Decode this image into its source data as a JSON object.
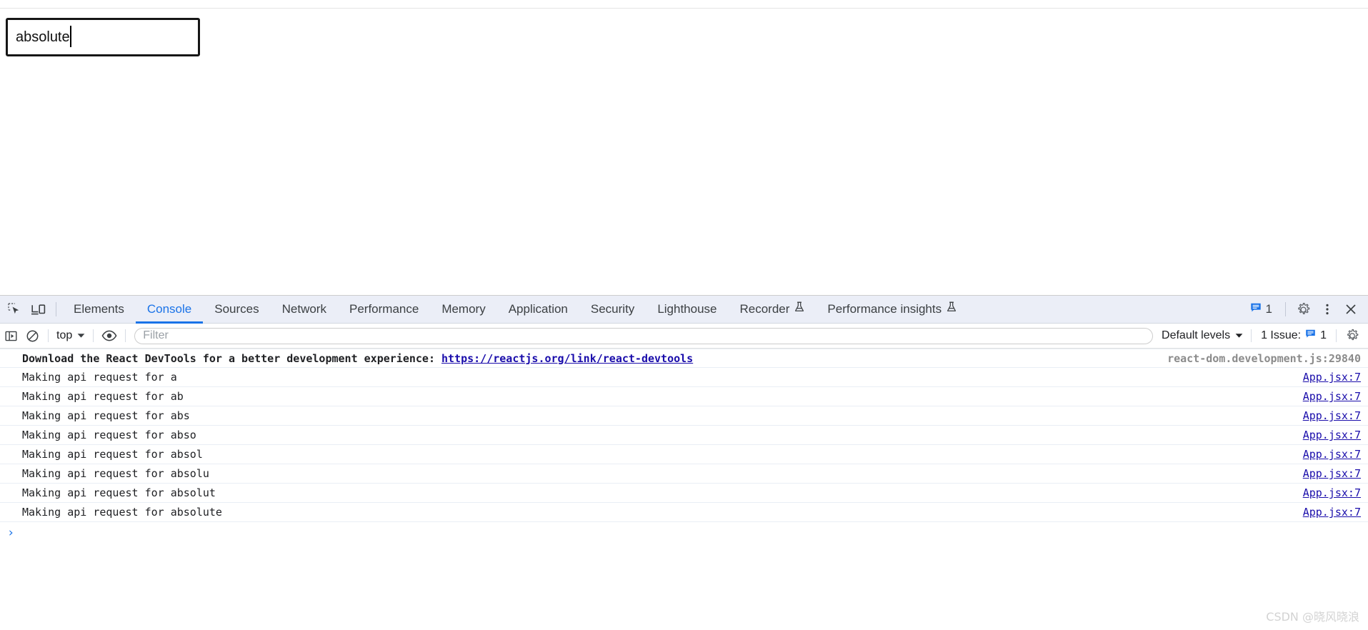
{
  "page": {
    "search_field": {
      "value": "absolute",
      "placeholder": ""
    }
  },
  "devtools": {
    "tabbar": {
      "inspect_icon": "inspect-cursor-icon",
      "device_toolbar_icon": "device-toolbar-icon",
      "tabs": [
        {
          "label": "Elements",
          "active": false,
          "icon": ""
        },
        {
          "label": "Console",
          "active": true,
          "icon": ""
        },
        {
          "label": "Sources",
          "active": false,
          "icon": ""
        },
        {
          "label": "Network",
          "active": false,
          "icon": ""
        },
        {
          "label": "Performance",
          "active": false,
          "icon": ""
        },
        {
          "label": "Memory",
          "active": false,
          "icon": ""
        },
        {
          "label": "Application",
          "active": false,
          "icon": ""
        },
        {
          "label": "Security",
          "active": false,
          "icon": ""
        },
        {
          "label": "Lighthouse",
          "active": false,
          "icon": ""
        },
        {
          "label": "Recorder",
          "active": false,
          "icon": "flask-icon"
        },
        {
          "label": "Performance insights",
          "active": false,
          "icon": "flask-icon"
        }
      ],
      "issues_count": "1",
      "settings_icon": "gear-icon",
      "more_icon": "kebab-menu-icon",
      "close_icon": "close-icon"
    },
    "console_toolbar": {
      "sidebar_toggle_icon": "console-sidebar-icon",
      "clear_icon": "clear-console-icon",
      "context_selector": "top",
      "eye_icon": "live-expression-eye-icon",
      "filter_placeholder": "Filter",
      "filter_value": "",
      "levels_label": "Default levels",
      "issues_label": "1 Issue:",
      "issues_count": "1",
      "settings_icon": "gear-icon"
    },
    "console_messages": [
      {
        "text": "Download the React DevTools for a better development experience: ",
        "link": "https://reactjs.org/link/react-devtools",
        "source": "react-dom.development.js:29840",
        "source_is_link": false,
        "bold": true
      },
      {
        "text": "Making api request for a",
        "link": "",
        "source": "App.jsx:7",
        "source_is_link": true,
        "bold": false
      },
      {
        "text": "Making api request for ab",
        "link": "",
        "source": "App.jsx:7",
        "source_is_link": true,
        "bold": false
      },
      {
        "text": "Making api request for abs",
        "link": "",
        "source": "App.jsx:7",
        "source_is_link": true,
        "bold": false
      },
      {
        "text": "Making api request for abso",
        "link": "",
        "source": "App.jsx:7",
        "source_is_link": true,
        "bold": false
      },
      {
        "text": "Making api request for absol",
        "link": "",
        "source": "App.jsx:7",
        "source_is_link": true,
        "bold": false
      },
      {
        "text": "Making api request for absolu",
        "link": "",
        "source": "App.jsx:7",
        "source_is_link": true,
        "bold": false
      },
      {
        "text": "Making api request for absolut",
        "link": "",
        "source": "App.jsx:7",
        "source_is_link": true,
        "bold": false
      },
      {
        "text": "Making api request for absolute",
        "link": "",
        "source": "App.jsx:7",
        "source_is_link": true,
        "bold": false
      }
    ],
    "prompt_symbol": "›"
  },
  "watermark": "CSDN @晓风晓浪",
  "colors": {
    "accent_blue": "#1a73e8",
    "link_blue": "#1a0dab",
    "tabbar_bg": "#ebeef7",
    "issue_blue": "#1a73e8"
  }
}
